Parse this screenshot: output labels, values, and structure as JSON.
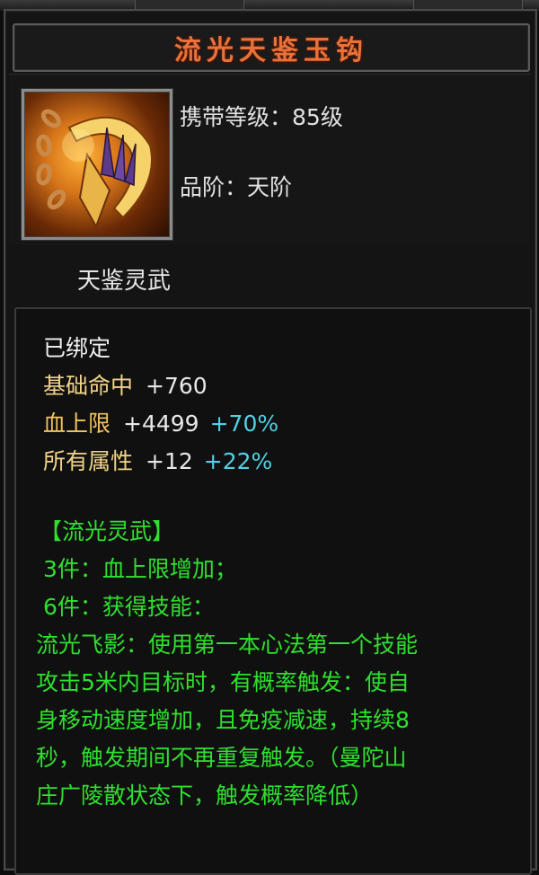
{
  "top_strip": [
    "",
    ""
  ],
  "item": {
    "name": "流光天鉴玉钩",
    "icon": "golden-hook-chain-icon",
    "carry_level_label": "携带等级",
    "carry_level_value": "85级",
    "quality_label": "品阶",
    "quality_value": "天阶",
    "separator": "：",
    "series_name": "天鉴灵武"
  },
  "status": {
    "bound": "已绑定"
  },
  "stats": [
    {
      "label": "基础命中",
      "value": "+760",
      "percent": ""
    },
    {
      "label": "血上限",
      "value": "+4499",
      "percent": "+70%"
    },
    {
      "label": "所有属性",
      "value": "+12",
      "percent": "+22%"
    }
  ],
  "set_bonus": {
    "title": "【流光灵武】",
    "piece3": "3件：血上限增加；",
    "piece6": "6件：获得技能：",
    "desc_lines": [
      "流光飞影：使用第一本心法第一个技能",
      "攻击5米内目标时，有概率触发：使自",
      "身移动速度增加，且免疫减速，持续8",
      "秒，触发期间不再重复触发。（曼陀山",
      "庄广陵散状态下，触发概率降低）"
    ]
  },
  "colors": {
    "title": "#e8723a",
    "white_text": "#f2f2f2",
    "stat_label": "#f3c35a",
    "percent": "#4fd1e6",
    "set_text": "#2fe02f"
  }
}
